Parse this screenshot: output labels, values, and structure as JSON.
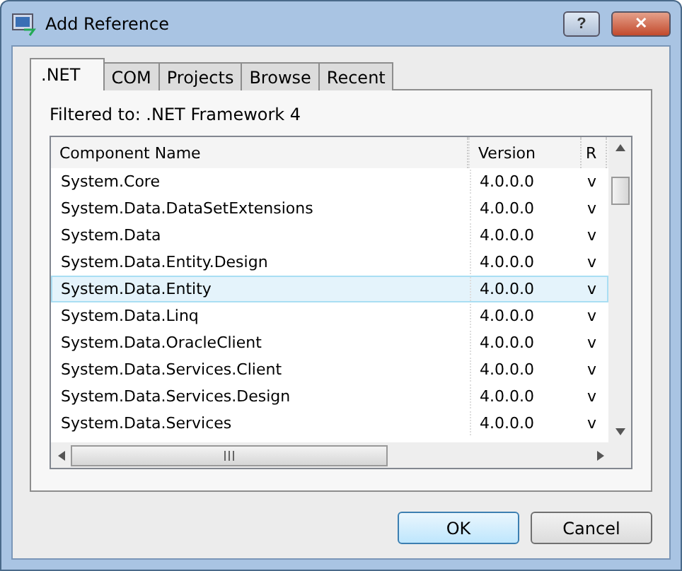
{
  "window": {
    "title": "Add Reference",
    "buttons": [
      "?",
      "✕"
    ]
  },
  "tabs": [
    {
      "label": ".NET",
      "selected": true
    },
    {
      "label": "COM",
      "selected": false
    },
    {
      "label": "Projects",
      "selected": false
    },
    {
      "label": "Browse",
      "selected": false
    },
    {
      "label": "Recent",
      "selected": false
    }
  ],
  "filter_label": "Filtered to: .NET Framework 4",
  "table": {
    "columns": [
      "Component Name",
      "Version",
      "R"
    ],
    "rows": [
      {
        "cells": [
          "System.Core",
          "4.0.0.0",
          "v"
        ],
        "selected": false
      },
      {
        "cells": [
          "System.Data.DataSetExtensions",
          "4.0.0.0",
          "v"
        ],
        "selected": false
      },
      {
        "cells": [
          "System.Data",
          "4.0.0.0",
          "v"
        ],
        "selected": false
      },
      {
        "cells": [
          "System.Data.Entity.Design",
          "4.0.0.0",
          "v"
        ],
        "selected": false
      },
      {
        "cells": [
          "System.Data.Entity",
          "4.0.0.0",
          "v"
        ],
        "selected": true
      },
      {
        "cells": [
          "System.Data.Linq",
          "4.0.0.0",
          "v"
        ],
        "selected": false
      },
      {
        "cells": [
          "System.Data.OracleClient",
          "4.0.0.0",
          "v"
        ],
        "selected": false
      },
      {
        "cells": [
          "System.Data.Services.Client",
          "4.0.0.0",
          "v"
        ],
        "selected": false
      },
      {
        "cells": [
          "System.Data.Services.Design",
          "4.0.0.0",
          "v"
        ],
        "selected": false
      },
      {
        "cells": [
          "System.Data.Services",
          "4.0.0.0",
          "v"
        ],
        "selected": false
      }
    ]
  },
  "buttons": [
    {
      "label": "OK",
      "default": true
    },
    {
      "label": "Cancel",
      "default": false
    }
  ]
}
